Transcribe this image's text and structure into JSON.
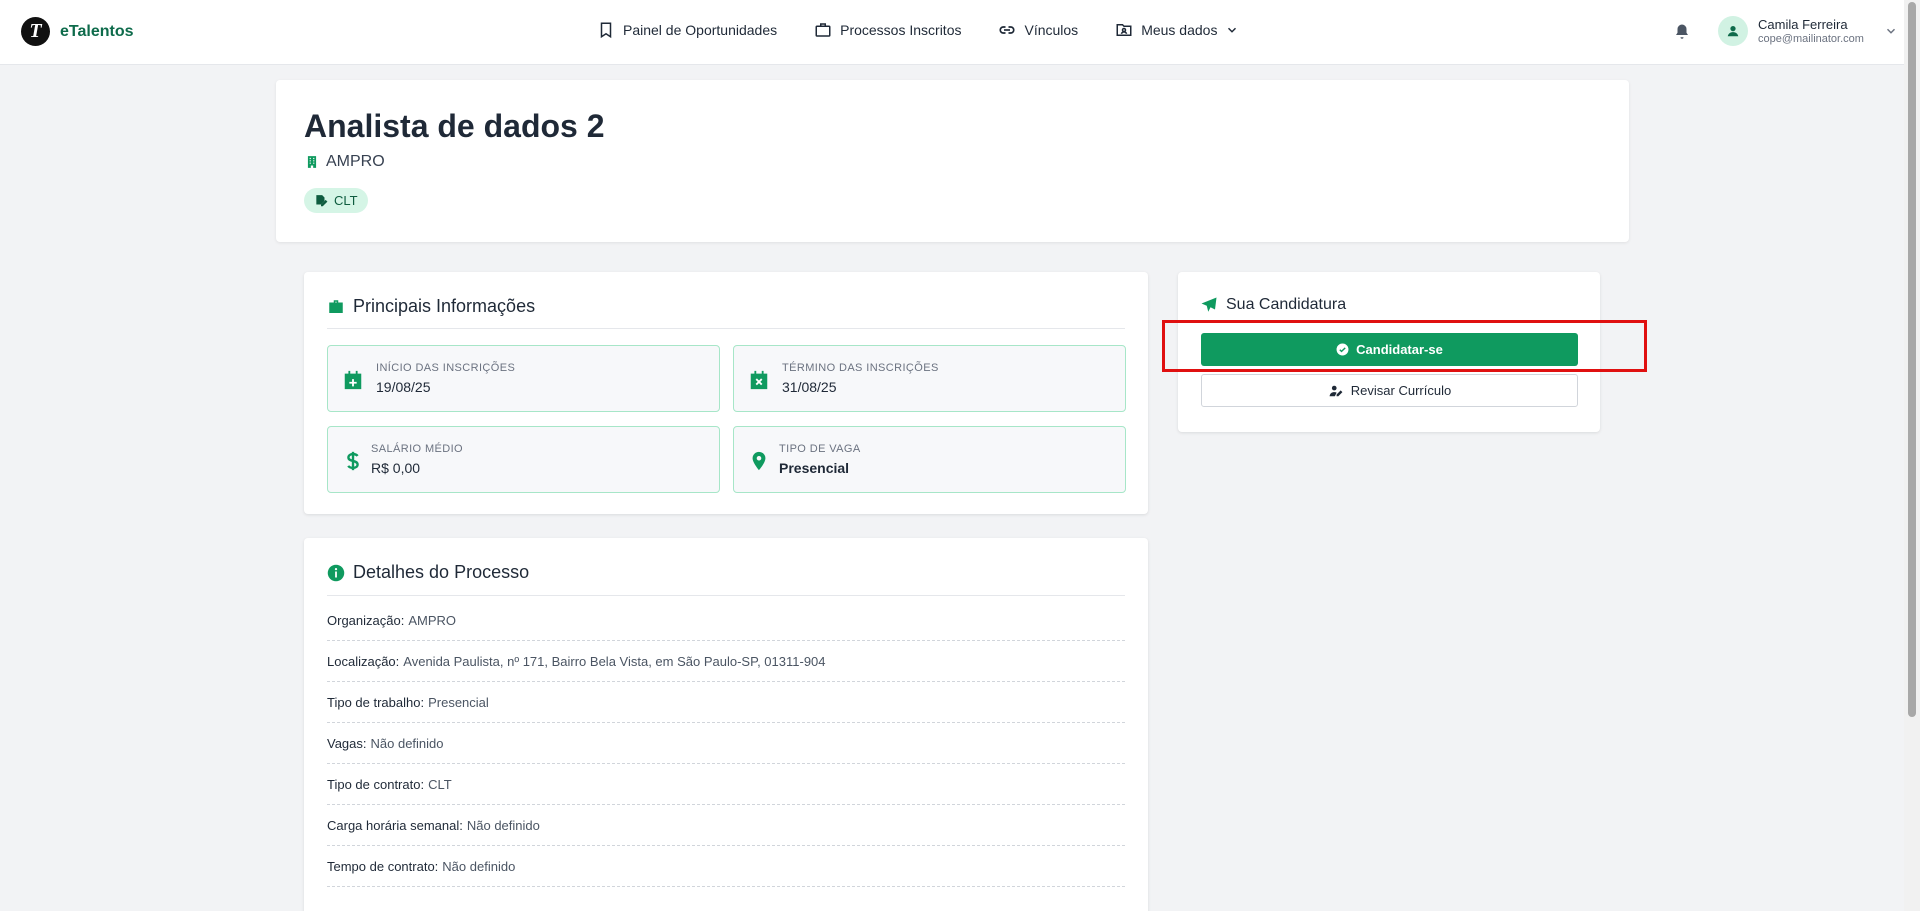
{
  "brand": {
    "name": "eTalentos",
    "logo_letter": "T"
  },
  "nav": {
    "items": [
      {
        "label": "Painel de Oportunidades",
        "icon": "bookmark-icon"
      },
      {
        "label": "Processos Inscritos",
        "icon": "briefcase-icon"
      },
      {
        "label": "Vínculos",
        "icon": "link-icon"
      },
      {
        "label": "Meus dados",
        "icon": "folder-user-icon"
      }
    ]
  },
  "user": {
    "name": "Camila Ferreira",
    "email": "cope@mailinator.com"
  },
  "job": {
    "title": "Analista de dados 2",
    "company": "AMPRO",
    "contract_badge": "CLT"
  },
  "info": {
    "title": "Principais Informações",
    "tiles": [
      {
        "label": "INÍCIO DAS INSCRIÇÕES",
        "value": "19/08/25",
        "icon": "calendar-plus-icon"
      },
      {
        "label": "TÉRMINO DAS INSCRIÇÕES",
        "value": "31/08/25",
        "icon": "calendar-x-icon"
      },
      {
        "label": "SALÁRIO MÉDIO",
        "value": "R$ 0,00",
        "icon": "dollar-icon"
      },
      {
        "label": "TIPO DE VAGA",
        "value": "Presencial",
        "icon": "map-pin-icon"
      }
    ]
  },
  "application": {
    "title": "Sua Candidatura",
    "apply_label": "Candidatar-se",
    "review_label": "Revisar Currículo"
  },
  "details": {
    "title": "Detalhes do Processo",
    "rows": [
      {
        "key": "Organização:",
        "value": "AMPRO"
      },
      {
        "key": "Localização:",
        "value": "Avenida Paulista, nº 171, Bairro Bela Vista, em São Paulo-SP, 01311-904"
      },
      {
        "key": "Tipo de trabalho:",
        "value": "Presencial"
      },
      {
        "key": "Vagas:",
        "value": "Não definido"
      },
      {
        "key": "Tipo de contrato:",
        "value": "CLT"
      },
      {
        "key": "Carga horária semanal:",
        "value": "Não definido"
      },
      {
        "key": "Tempo de contrato:",
        "value": "Não definido"
      }
    ]
  },
  "colors": {
    "brand": "#0e6b4b",
    "primary": "#0f9a5f",
    "accent_border": "#a7e6c8",
    "highlight": "#e01010"
  }
}
